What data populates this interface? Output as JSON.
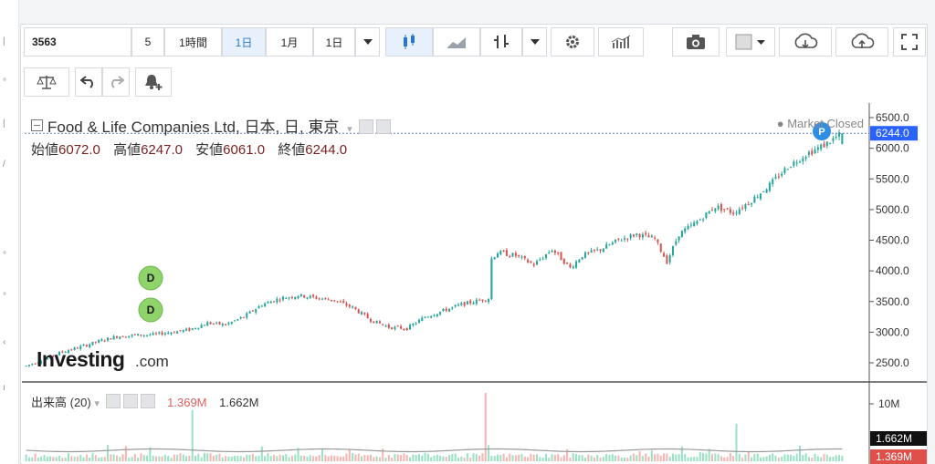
{
  "toolbar": {
    "symbol": "3563",
    "interval_value": "5",
    "interval_unit": "1時間",
    "btn_1d": "1日",
    "btn_1m": "1月",
    "btn_1d_b": "1日"
  },
  "legend": {
    "title": "Food & Life Companies Ltd, 日本, 日, 東京",
    "open_label": "始値",
    "open": "6072.0",
    "high_label": "高値",
    "high": "6247.0",
    "low_label": "安値",
    "low": "6061.0",
    "close_label": "終値",
    "close": "6244.0",
    "status": "Market Closed"
  },
  "volume_legend": {
    "title": "出来高 (20)",
    "v1": "1.369M",
    "v2": "1.662M"
  },
  "logo": {
    "main": "Investing",
    "suffix": ".com"
  },
  "markers": {
    "dividend": "D",
    "p": "P"
  },
  "colors": {
    "up": "#26a69a",
    "down": "#d9534f",
    "vol_up": "#9be2c5",
    "vol_down": "#f7b6b2",
    "price_badge": "#2962ff",
    "accent": "#2a77c9"
  },
  "chart_data": {
    "type": "candlestick",
    "title": "Food & Life Companies Ltd, 日本, 日, 東京",
    "price_axis": {
      "ticks": [
        2500,
        3000,
        3500,
        4000,
        4500,
        5000,
        5500,
        6000,
        6500
      ],
      "range": [
        2350,
        6650
      ]
    },
    "last_price_label": "6244.0",
    "last_ohlc": {
      "open": 6072.0,
      "high": 6247.0,
      "low": 6061.0,
      "close": 6244.0
    },
    "price_anchors": [
      [
        0,
        2450
      ],
      [
        6,
        2560
      ],
      [
        12,
        2680
      ],
      [
        18,
        2760
      ],
      [
        24,
        2850
      ],
      [
        30,
        2930
      ],
      [
        36,
        2950
      ],
      [
        42,
        2960
      ],
      [
        48,
        3000
      ],
      [
        54,
        3040
      ],
      [
        60,
        3150
      ],
      [
        66,
        3120
      ],
      [
        72,
        3250
      ],
      [
        78,
        3450
      ],
      [
        84,
        3550
      ],
      [
        90,
        3600
      ],
      [
        96,
        3560
      ],
      [
        102,
        3520
      ],
      [
        108,
        3400
      ],
      [
        114,
        3200
      ],
      [
        120,
        3080
      ],
      [
        126,
        3060
      ],
      [
        132,
        3250
      ],
      [
        138,
        3350
      ],
      [
        144,
        3450
      ],
      [
        150,
        3520
      ],
      [
        153,
        3550
      ],
      [
        154,
        4200
      ],
      [
        156,
        4300
      ],
      [
        162,
        4250
      ],
      [
        168,
        4100
      ],
      [
        174,
        4350
      ],
      [
        180,
        4050
      ],
      [
        184,
        4250
      ],
      [
        190,
        4350
      ],
      [
        196,
        4500
      ],
      [
        202,
        4600
      ],
      [
        208,
        4520
      ],
      [
        212,
        4150
      ],
      [
        216,
        4600
      ],
      [
        222,
        4800
      ],
      [
        228,
        5050
      ],
      [
        234,
        4950
      ],
      [
        240,
        5150
      ],
      [
        246,
        5400
      ],
      [
        252,
        5700
      ],
      [
        258,
        5900
      ],
      [
        264,
        6050
      ],
      [
        270,
        6244
      ]
    ],
    "volume_axis": {
      "ticks": [
        "10M"
      ],
      "labels": [
        "1.662M",
        "1.369M"
      ]
    },
    "volume_spikes": {
      "55": 0.75,
      "152": 1.0,
      "235": 0.55
    }
  }
}
